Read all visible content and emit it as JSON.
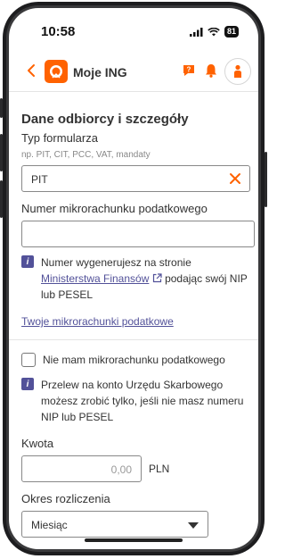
{
  "status_bar": {
    "time": "10:58",
    "battery": "81"
  },
  "header": {
    "app_title": "Moje ING"
  },
  "form": {
    "section_title": "Dane odbiorcy i szczegóły",
    "form_type_label": "Typ formularza",
    "form_type_hint": "np. PIT, CIT, PCC, VAT, mandaty",
    "form_type_value": "PIT",
    "account_label": "Numer mikrorachunku podatkowego",
    "account_value": "",
    "info1_text_before": "Numer wygenerujesz na stronie",
    "info1_link": "Ministerstwa Finansów",
    "info1_text_after": "podając swój NIP lub PESEL",
    "my_accounts_link": "Twoje mikrorachunki podatkowe",
    "checkbox_label": "Nie mam mikrorachunku podatkowego",
    "info2_text": "Przelew na konto Urzędu Skarbowego możesz zrobić tylko, jeśli nie masz numeru NIP lub PESEL",
    "amount_label": "Kwota",
    "amount_placeholder": "0,00",
    "currency": "PLN",
    "period_label": "Okres rozliczenia",
    "period_value": "Miesiąc"
  },
  "colors": {
    "accent": "#ff6200",
    "info": "#525199"
  }
}
